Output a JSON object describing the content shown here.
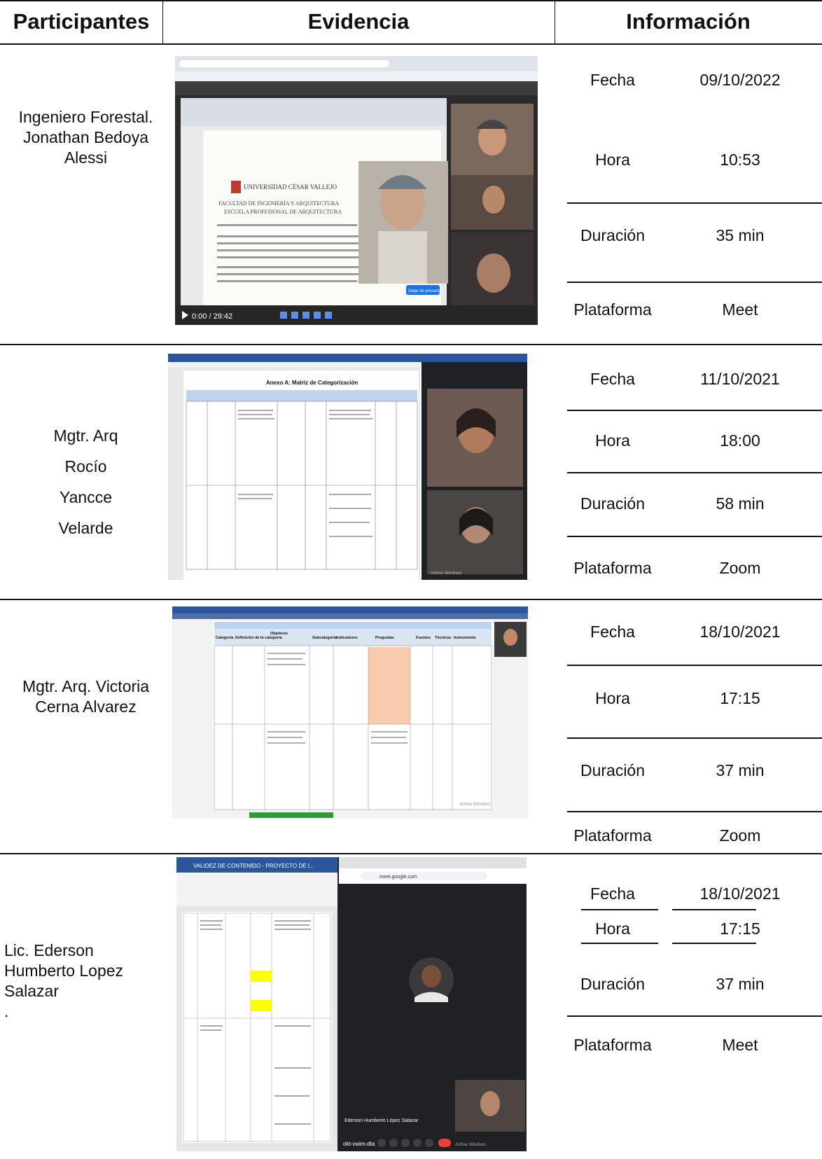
{
  "headers": {
    "participantes": "Participantes",
    "evidencia": "Evidencia",
    "informacion": "Información"
  },
  "rows": [
    {
      "participant": [
        "Ingeniero Forestal.",
        "Jonathan Bedoya",
        "Alessi"
      ],
      "info": [
        {
          "label": "Fecha",
          "value": "09/10/2022"
        },
        {
          "label": "Hora",
          "value": "10:53"
        },
        {
          "label": "Duración",
          "value": "35 min"
        },
        {
          "label": "Plataforma",
          "value": "Meet"
        }
      ],
      "shot": {
        "doc_title": "UNIVERSIDAD CÉSAR VALLEJO",
        "doc_lines": [
          "FACULTAD DE INGENIERÍA Y ARQUITECTURA",
          "ESCUELA PROFESIONAL DE ARQUITECTURA"
        ],
        "time": "0:00 / 29:42",
        "present_label": "Dejar de presentar"
      }
    },
    {
      "participant": [
        "Mgtr. Arq",
        "Rocío",
        "Yancce",
        "Velarde"
      ],
      "info": [
        {
          "label": "Fecha",
          "value": "11/10/2021"
        },
        {
          "label": "Hora",
          "value": "18:00"
        },
        {
          "label": "Duración",
          "value": "58 min"
        },
        {
          "label": "Plataforma",
          "value": "Zoom"
        }
      ],
      "shot": {
        "doc_title": "Anexo A: Matriz de Categorización",
        "watermark": "Activar Windows"
      }
    },
    {
      "participant": [
        "Mgtr. Arq. Victoria",
        "Cerna Alvarez"
      ],
      "info": [
        {
          "label": "Fecha",
          "value": "18/10/2021"
        },
        {
          "label": "Hora",
          "value": "17:15"
        },
        {
          "label": "Duración",
          "value": "37 min"
        },
        {
          "label": "Plataforma",
          "value": "Zoom"
        }
      ],
      "shot": {
        "columns": [
          "Categoría",
          "Definición de la categoría",
          "Objetivos",
          "Subcategoría",
          "Indicadores",
          "Preguntas",
          "Fuentes",
          "Técnicas",
          "Instrumento"
        ],
        "watermark": "Activar Windows"
      }
    },
    {
      "participant": [
        "Lic. Ederson",
        "Humberto Lopez",
        "Salazar",
        "."
      ],
      "info": [
        {
          "label": "Fecha",
          "value": "18/10/2021"
        },
        {
          "label": "Hora",
          "value": "17:15"
        },
        {
          "label": "Duración",
          "value": "37 min"
        },
        {
          "label": "Plataforma",
          "value": "Meet"
        }
      ],
      "shot": {
        "word_title": "VALIDEZ DE CONTENIDO - PROYECTO DE I...",
        "url": "meet.google.com",
        "caller_name": "Ederson Humberto López Salazar",
        "meeting_code": "okt-vwim-dta",
        "watermark": "Activar Windows"
      }
    }
  ]
}
